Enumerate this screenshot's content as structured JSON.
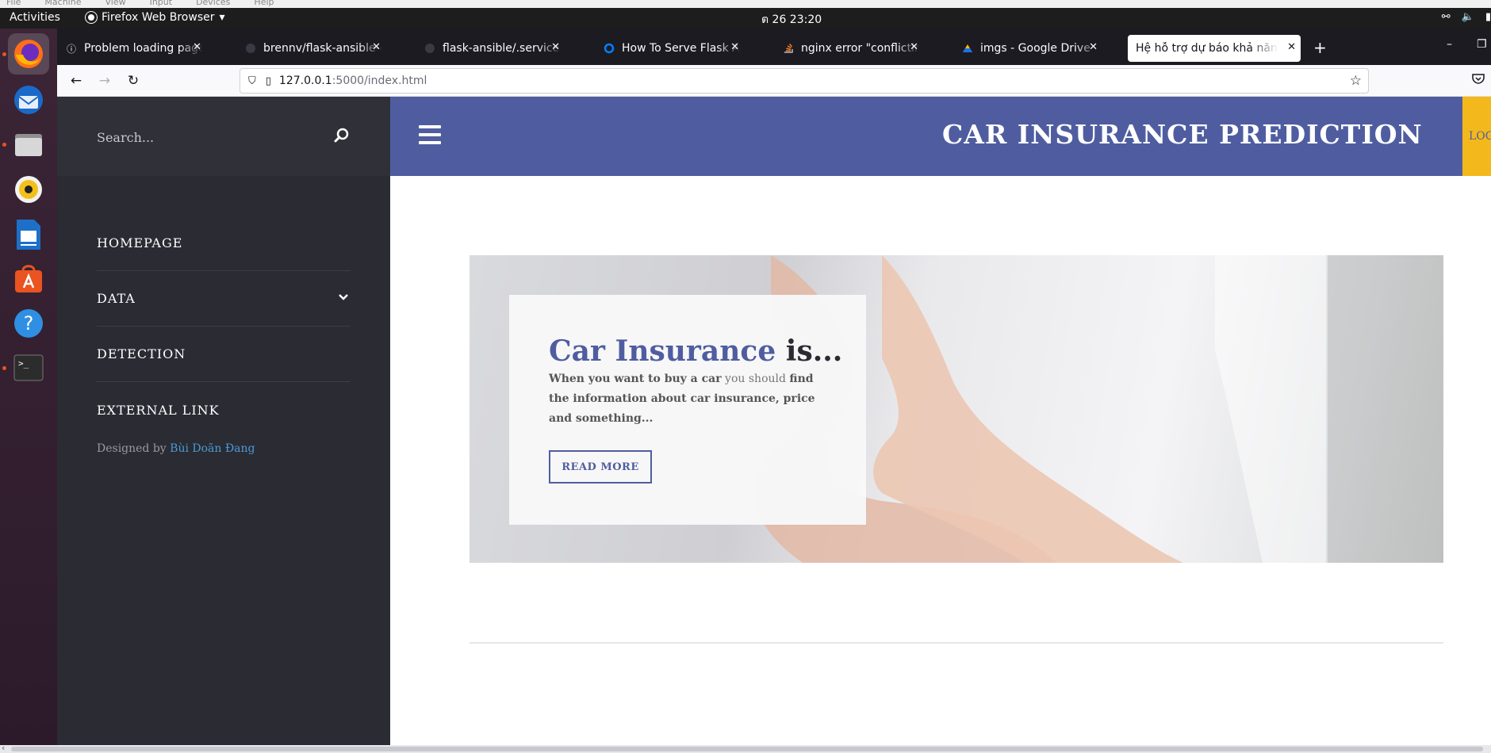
{
  "vm_menu": [
    "File",
    "Machine",
    "View",
    "Input",
    "Devices",
    "Help"
  ],
  "system": {
    "activities": "Activities",
    "app_menu": "Firefox Web Browser",
    "clock": "ต 26  23:20"
  },
  "dock": [
    {
      "name": "firefox-icon",
      "running": true
    },
    {
      "name": "thunderbird-icon",
      "running": false
    },
    {
      "name": "files-icon",
      "running": true
    },
    {
      "name": "rhythmbox-icon",
      "running": false
    },
    {
      "name": "libreoffice-writer-icon",
      "running": false
    },
    {
      "name": "app-center-icon",
      "running": false
    },
    {
      "name": "help-icon",
      "running": false
    },
    {
      "name": "terminal-icon",
      "running": true
    }
  ],
  "browser": {
    "tabs": [
      {
        "label": "Problem loading page",
        "icon": "info-icon",
        "selected": false
      },
      {
        "label": "brennv/flask-ansible-example",
        "icon": "github-icon",
        "selected": false
      },
      {
        "label": "flask-ansible/.service at master",
        "icon": "github-icon",
        "selected": false
      },
      {
        "label": "How To Serve Flask Applications",
        "icon": "digitalocean-icon",
        "selected": false
      },
      {
        "label": "nginx error \"conflicting server name\"",
        "icon": "stackoverflow-icon",
        "selected": false
      },
      {
        "label": "imgs - Google Drive",
        "icon": "google-drive-icon",
        "selected": false
      },
      {
        "label": "Hệ hỗ trợ dự báo khả năng tham gia bảo hiểm",
        "icon": "",
        "selected": true
      }
    ],
    "new_tab": "+",
    "url_host": "127.0.0.1",
    "url_rest": ":5000/index.html"
  },
  "site": {
    "search_placeholder": "Search...",
    "menu": [
      {
        "label": "HOMEPAGE",
        "has_submenu": false
      },
      {
        "label": "DATA",
        "has_submenu": true
      },
      {
        "label": "DETECTION",
        "has_submenu": false
      },
      {
        "label": "EXTERNAL LINK",
        "has_submenu": false
      }
    ],
    "credit_prefix": "Designed by ",
    "credit_name": "Bùi Doãn Đang",
    "title": "CAR INSURANCE PREDICTION",
    "login_label": "LOGIN",
    "banner": {
      "title_highlight": "Car Insurance",
      "title_rest": " is...",
      "text_1": "When you want to buy a car",
      "text_2": " you should ",
      "text_3": "find the information about car insurance, price and something...",
      "button": "READ MORE"
    }
  },
  "colors": {
    "header_bg": "#4f5da0",
    "sidebar_bg": "#2a2b33",
    "login_bg": "#f3b81b",
    "link": "#4a9bd4"
  }
}
